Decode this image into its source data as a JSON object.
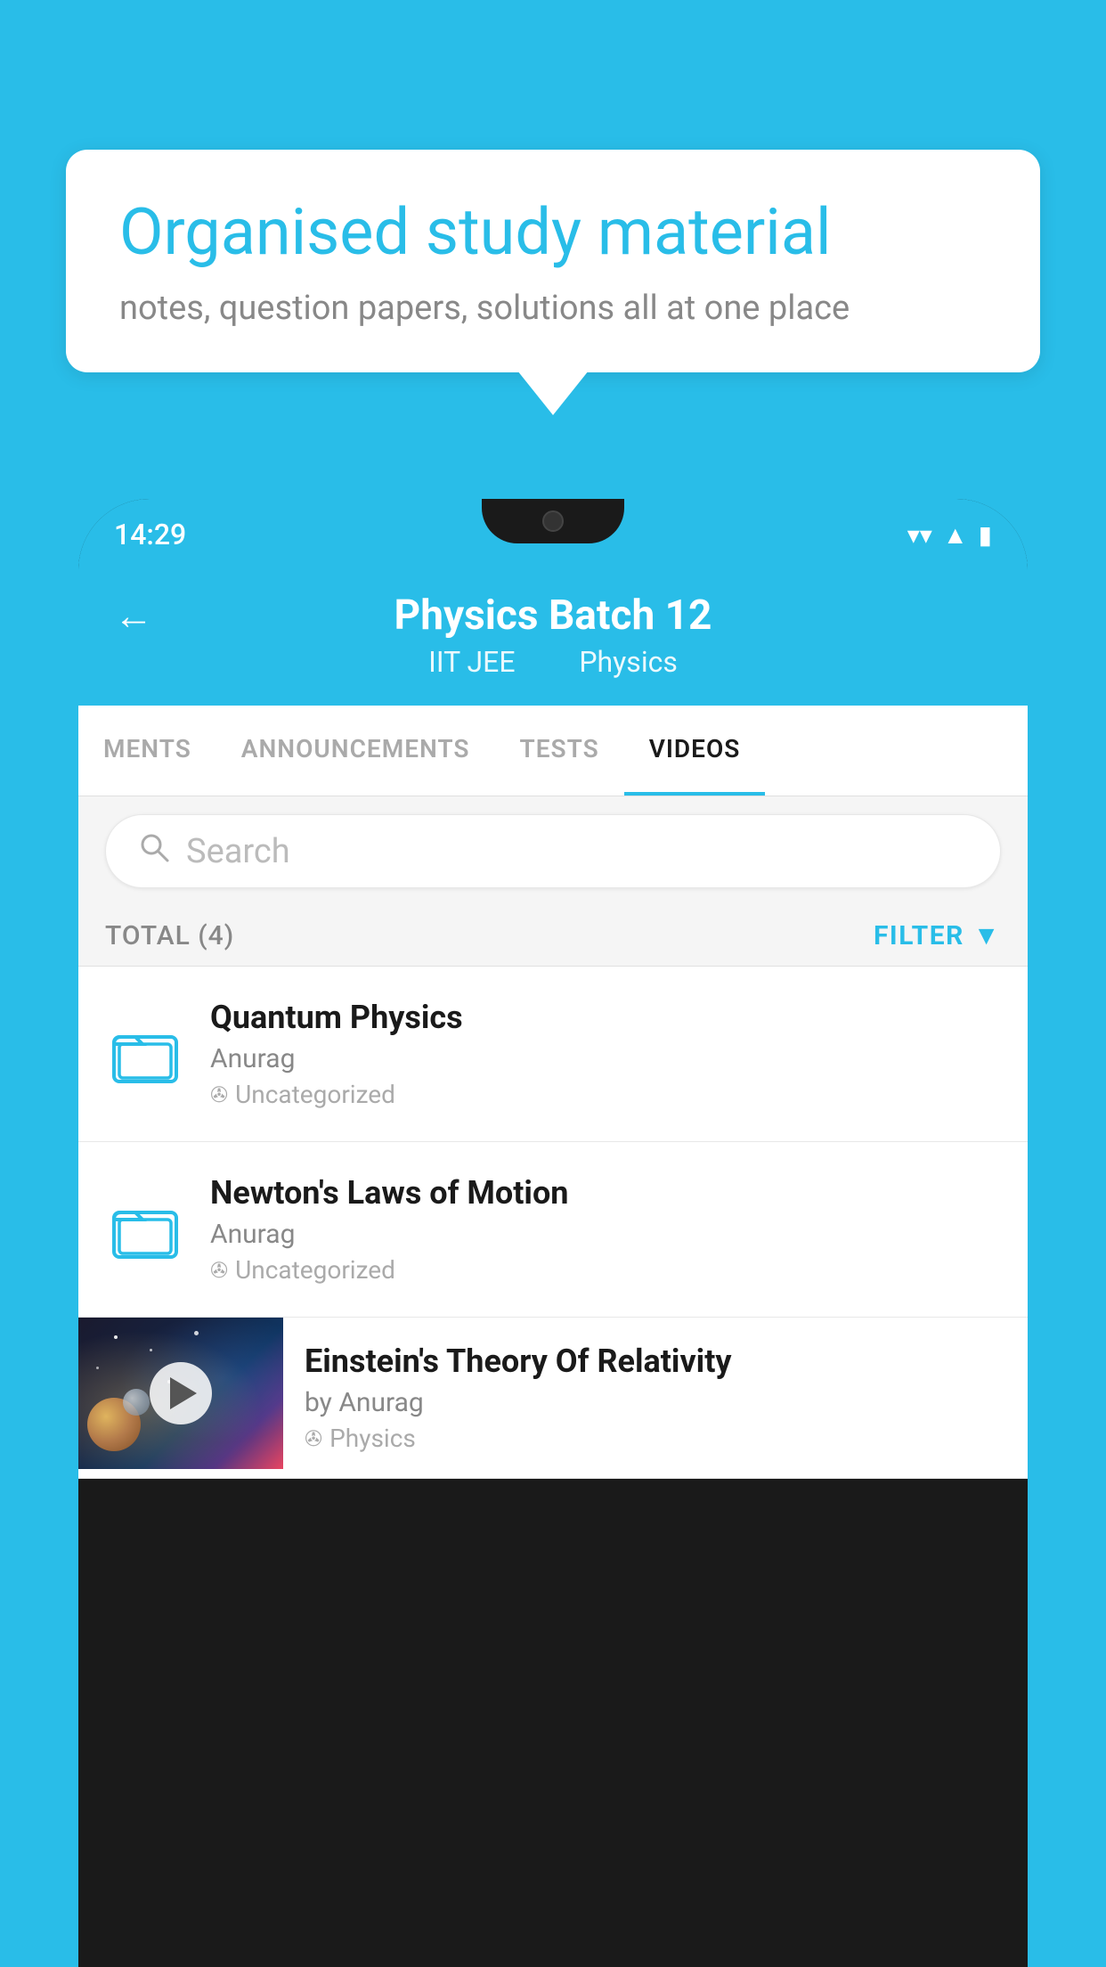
{
  "background": {
    "color": "#29bde8"
  },
  "speech_bubble": {
    "title": "Organised study material",
    "subtitle": "notes, question papers, solutions all at one place"
  },
  "phone": {
    "status_bar": {
      "time": "14:29"
    },
    "header": {
      "title": "Physics Batch 12",
      "subtitle_left": "IIT JEE",
      "subtitle_right": "Physics"
    },
    "tabs": [
      {
        "label": "MENTS",
        "active": false
      },
      {
        "label": "ANNOUNCEMENTS",
        "active": false
      },
      {
        "label": "TESTS",
        "active": false
      },
      {
        "label": "VIDEOS",
        "active": true
      }
    ],
    "search": {
      "placeholder": "Search"
    },
    "filter": {
      "total_label": "TOTAL (4)",
      "button_label": "FILTER"
    },
    "videos": [
      {
        "id": 1,
        "title": "Quantum Physics",
        "author": "Anurag",
        "tag": "Uncategorized",
        "has_thumbnail": false
      },
      {
        "id": 2,
        "title": "Newton's Laws of Motion",
        "author": "Anurag",
        "tag": "Uncategorized",
        "has_thumbnail": false
      },
      {
        "id": 3,
        "title": "Einstein's Theory Of Relativity",
        "author": "by Anurag",
        "tag": "Physics",
        "has_thumbnail": true
      }
    ]
  }
}
